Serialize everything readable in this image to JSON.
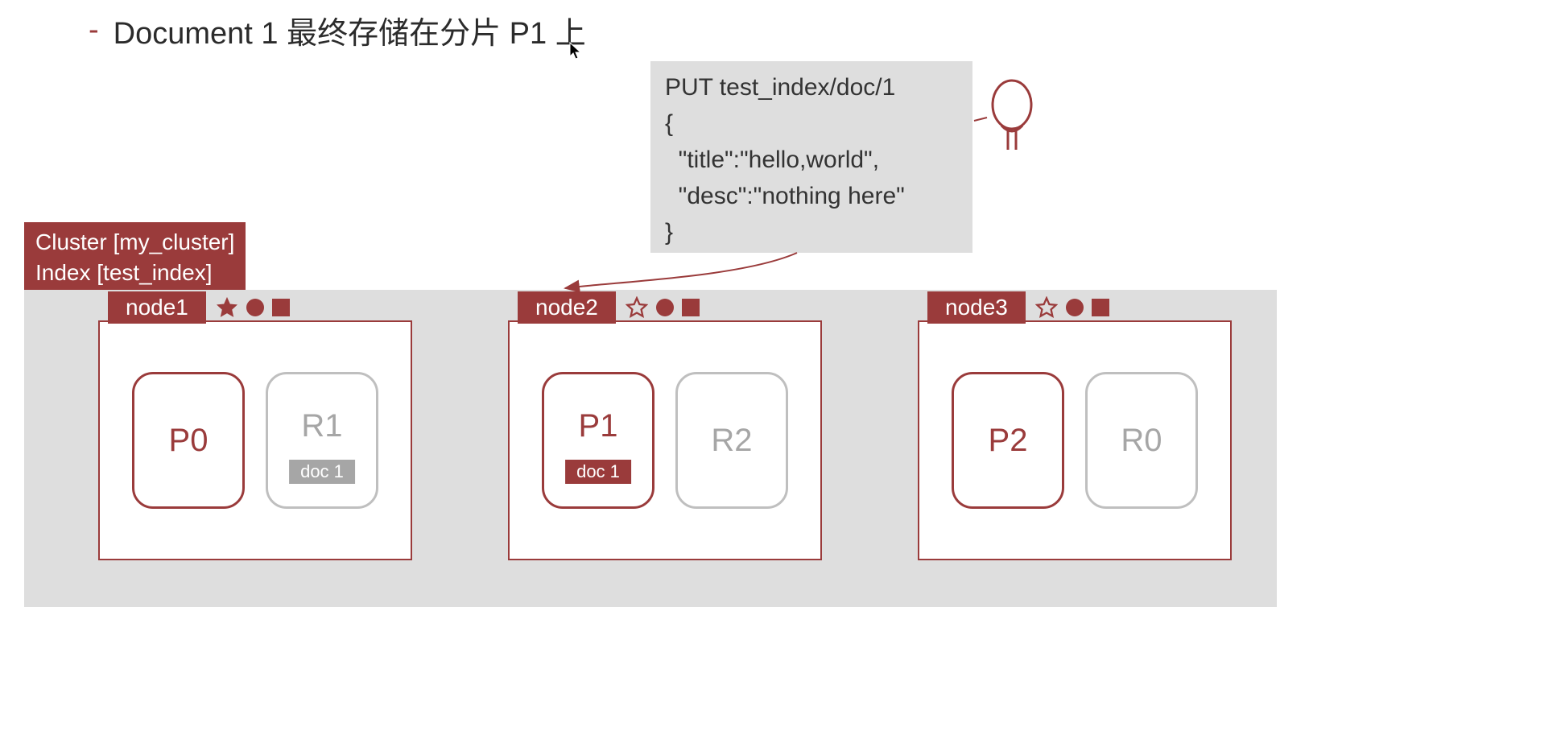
{
  "title": {
    "dash": "-",
    "text": "Document 1 最终存储在分片 P1 上"
  },
  "code": {
    "line1": "PUT test_index/doc/1",
    "line2": "{",
    "line3": "  \"title\":\"hello,world\",",
    "line4": "  \"desc\":\"nothing here\"",
    "line5": "}"
  },
  "cluster_label": {
    "line1": "Cluster [my_cluster]",
    "line2": "Index [test_index]"
  },
  "nodes": {
    "node1": {
      "name": "node1",
      "star_filled": true,
      "shard_a": "P0",
      "shard_b": "R1",
      "doc_b": "doc 1"
    },
    "node2": {
      "name": "node2",
      "star_filled": false,
      "shard_a": "P1",
      "doc_a": "doc 1",
      "shard_b": "R2"
    },
    "node3": {
      "name": "node3",
      "star_filled": false,
      "shard_a": "P2",
      "shard_b": "R0"
    }
  }
}
